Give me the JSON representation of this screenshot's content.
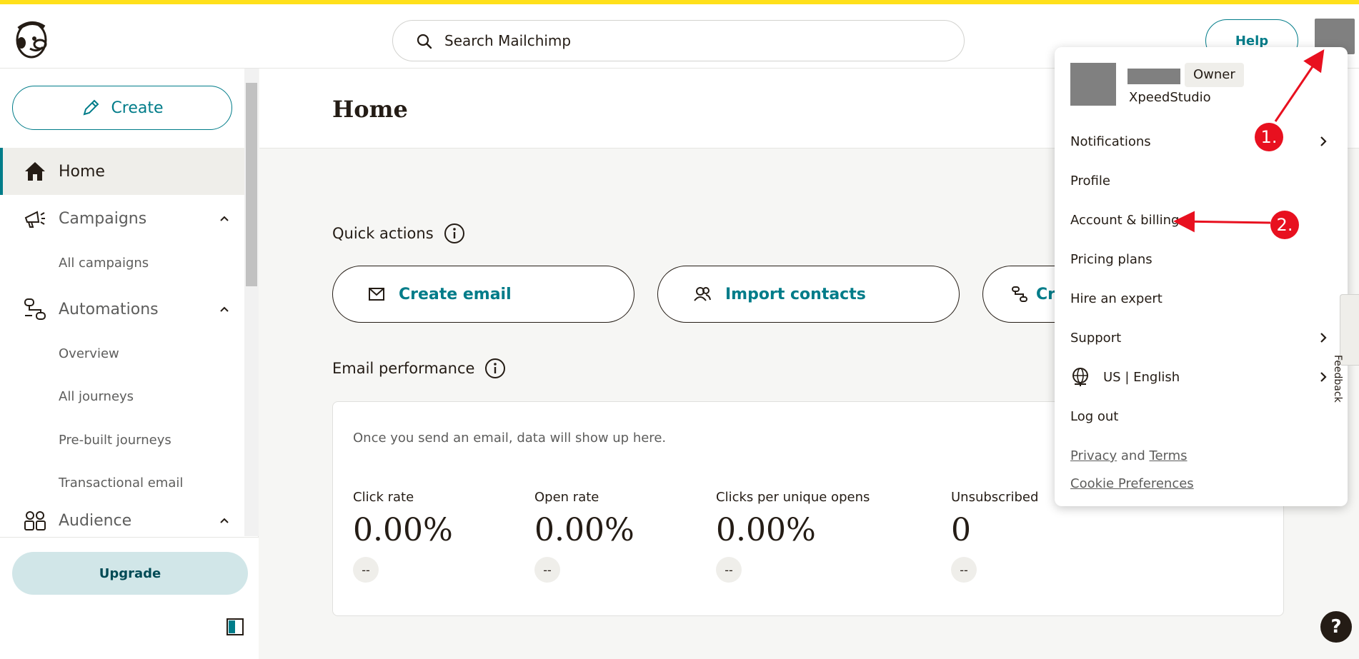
{
  "header": {
    "search_placeholder": "Search Mailchimp",
    "help_label": "Help"
  },
  "sidebar": {
    "create_label": "Create",
    "nav": [
      {
        "label": "Home"
      },
      {
        "label": "Campaigns",
        "subitems": [
          "All campaigns"
        ]
      },
      {
        "label": "Automations",
        "subitems": [
          "Overview",
          "All journeys",
          "Pre-built journeys",
          "Transactional email"
        ]
      },
      {
        "label": "Audience"
      }
    ],
    "upgrade_label": "Upgrade"
  },
  "main": {
    "title": "Home",
    "quick_actions_title": "Quick actions",
    "quick_actions": [
      {
        "label": "Create email",
        "icon": "envelope-icon"
      },
      {
        "label": "Import contacts",
        "icon": "contacts-icon"
      },
      {
        "label": "Cr",
        "icon": "automation-icon"
      }
    ],
    "email_performance": {
      "title": "Email performance",
      "empty_text": "Once you send an email, data will show up here.",
      "metrics": [
        {
          "label": "Click rate",
          "value": "0.00%",
          "delta": "--"
        },
        {
          "label": "Open rate",
          "value": "0.00%",
          "delta": "--"
        },
        {
          "label": "Clicks per unique opens",
          "value": "0.00%",
          "delta": "--"
        },
        {
          "label": "Unsubscribed",
          "value": "0",
          "delta": "--"
        }
      ]
    }
  },
  "account_menu": {
    "role": "Owner",
    "org": "XpeedStudio",
    "items": [
      "Notifications",
      "Profile",
      "Account & billing",
      "Pricing plans",
      "Hire an expert",
      "Support",
      "US | English",
      "Log out"
    ],
    "privacy": "Privacy",
    "and": "and",
    "terms": "Terms",
    "cookie": "Cookie Preferences"
  },
  "annotations": [
    "1.",
    "2."
  ],
  "feedback_label": "Feedback",
  "help_bubble": "?",
  "colors": {
    "accent": "#007c89",
    "brand_yellow": "#ffe01b",
    "annotation_red": "#e8101f"
  }
}
